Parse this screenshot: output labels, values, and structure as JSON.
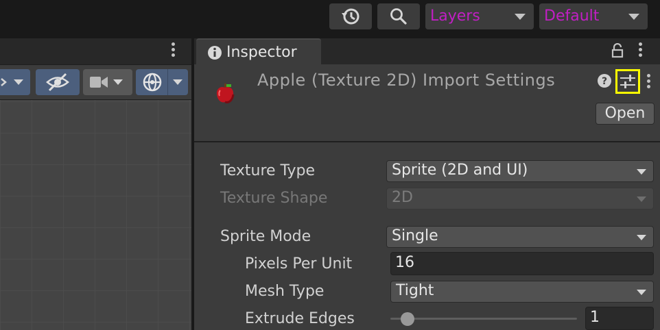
{
  "toolbar": {
    "history_icon": "history-icon",
    "search_icon": "search-icon",
    "layers_label": "Layers",
    "layout_label": "Default",
    "accent_color": "#c11fc4"
  },
  "scene": {
    "visibility_icon": "eye-slash-icon",
    "camera_icon": "camera-icon",
    "gizmo_icon": "gizmo-globe-icon"
  },
  "inspector": {
    "tab_label": "Inspector",
    "header_title": "Apple (Texture 2D) Import Settings",
    "open_label": "Open",
    "fields": {
      "texture_type": {
        "label": "Texture Type",
        "value": "Sprite (2D and UI)"
      },
      "texture_shape": {
        "label": "Texture Shape",
        "value": "2D"
      },
      "sprite_mode": {
        "label": "Sprite Mode",
        "value": "Single"
      },
      "pixels_per_unit": {
        "label": "Pixels Per Unit",
        "value": "16"
      },
      "mesh_type": {
        "label": "Mesh Type",
        "value": "Tight"
      },
      "extrude_edges": {
        "label": "Extrude Edges",
        "value": "1",
        "slider_fraction": 0.06
      }
    },
    "highlight_color": "#ffff00"
  }
}
